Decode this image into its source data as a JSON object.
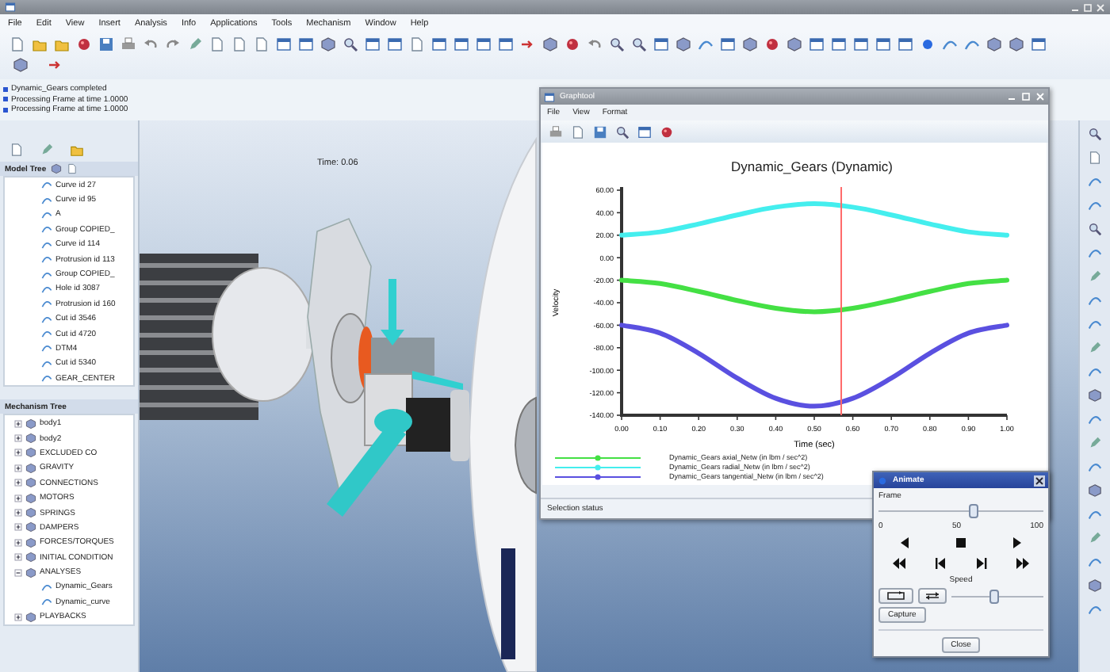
{
  "menu_bar": [
    "File",
    "Edit",
    "View",
    "Insert",
    "Analysis",
    "Info",
    "Applications",
    "Tools",
    "Mechanism",
    "Window",
    "Help"
  ],
  "messages": [
    "Dynamic_Gears completed",
    "Processing Frame at time 1.0000",
    "Processing Frame at time 1.0000"
  ],
  "model_tree": {
    "title": "Model Tree",
    "items": [
      {
        "label": "Curve id 27"
      },
      {
        "label": "Curve id 95"
      },
      {
        "label": "A"
      },
      {
        "label": "Group COPIED_"
      },
      {
        "label": "Curve id 114"
      },
      {
        "label": "Protrusion id 113"
      },
      {
        "label": "Group COPIED_"
      },
      {
        "label": "Hole id 3087"
      },
      {
        "label": "Protrusion id 160"
      },
      {
        "label": "Cut id 3546"
      },
      {
        "label": "Cut id 4720"
      },
      {
        "label": "DTM4"
      },
      {
        "label": "Cut id 5340"
      },
      {
        "label": "GEAR_CENTER"
      }
    ]
  },
  "mechanism_tree": {
    "title": "Mechanism Tree",
    "items": [
      {
        "label": "body1",
        "expanded": false
      },
      {
        "label": "body2",
        "expanded": false
      },
      {
        "label": "EXCLUDED CO",
        "expanded": false
      },
      {
        "label": "GRAVITY",
        "expanded": false
      },
      {
        "label": "CONNECTIONS",
        "expanded": false
      },
      {
        "label": "MOTORS",
        "expanded": false
      },
      {
        "label": "SPRINGS",
        "expanded": false
      },
      {
        "label": "DAMPERS",
        "expanded": false
      },
      {
        "label": "FORCES/TORQUES",
        "expanded": false
      },
      {
        "label": "INITIAL CONDITION",
        "expanded": false
      },
      {
        "label": "ANALYSES",
        "expanded": true,
        "children": [
          {
            "label": "Dynamic_Gears"
          },
          {
            "label": "Dynamic_curve"
          }
        ]
      },
      {
        "label": "PLAYBACKS",
        "expanded": false
      }
    ]
  },
  "viewport": {
    "time_label": "Time: 0.06"
  },
  "graph_window": {
    "title": "Graphtool",
    "menu": [
      "File",
      "View",
      "Format"
    ],
    "chart_data": {
      "type": "line",
      "title": "Dynamic_Gears (Dynamic)",
      "xlabel": "Time (sec)",
      "ylabel": "Velocity",
      "x": [
        0,
        0.1,
        0.2,
        0.3,
        0.4,
        0.5,
        0.6,
        0.7,
        0.8,
        0.9,
        1.0
      ],
      "series": [
        {
          "name": "Dynamic_Gears axial_Netw (in lbm / sec^2)",
          "color": "#44e044",
          "values": [
            -20,
            -23,
            -30,
            -38,
            -45,
            -48,
            -45,
            -38,
            -30,
            -23,
            -20
          ]
        },
        {
          "name": "Dynamic_Gears radial_Netw (in lbm / sec^2)",
          "color": "#44eeee",
          "values": [
            20,
            23,
            30,
            38,
            45,
            48,
            45,
            38,
            30,
            23,
            20
          ]
        },
        {
          "name": "Dynamic_Gears tangential_Netw (in lbm / sec^2)",
          "color": "#5a50e0",
          "values": [
            -60,
            -67,
            -85,
            -107,
            -125,
            -132,
            -125,
            -107,
            -85,
            -67,
            -60
          ]
        }
      ],
      "xlim": [
        0,
        1
      ],
      "ylim": [
        -140,
        60
      ],
      "xticks": [
        {
          "value": 0,
          "label": "0.00"
        },
        {
          "value": 0.1,
          "label": "0.10"
        },
        {
          "value": 0.2,
          "label": "0.20"
        },
        {
          "value": 0.3,
          "label": "0.30"
        },
        {
          "value": 0.4,
          "label": "0.40"
        },
        {
          "value": 0.5,
          "label": "0.50"
        },
        {
          "value": 0.6,
          "label": "0.60"
        },
        {
          "value": 0.7,
          "label": "0.70"
        },
        {
          "value": 0.8,
          "label": "0.80"
        },
        {
          "value": 0.9,
          "label": "0.90"
        },
        {
          "value": 1,
          "label": "1.00"
        }
      ],
      "yticks": [
        {
          "value": 60,
          "label": "60.00"
        },
        {
          "value": 40,
          "label": "40.00"
        },
        {
          "value": 20,
          "label": "20.00"
        },
        {
          "value": 0,
          "label": "0.00"
        },
        {
          "value": -20,
          "label": "-20.00"
        },
        {
          "value": -40,
          "label": "-40.00"
        },
        {
          "value": -60,
          "label": "-60.00"
        },
        {
          "value": -80,
          "label": "-80.00"
        },
        {
          "value": -100,
          "label": "-100.00"
        },
        {
          "value": -120,
          "label": "-120.00"
        },
        {
          "value": -140,
          "label": "-140.00"
        }
      ],
      "ref_lines": [
        {
          "axis": "x",
          "value": 0.57
        }
      ]
    },
    "status": "Selection status"
  },
  "animate_dialog": {
    "title": "Animate",
    "frame_label": "Frame",
    "frame_slider": {
      "level": 0.58
    },
    "frame_ticks": [
      "0",
      "50",
      "100"
    ],
    "speed_label": "Speed",
    "speed_slider": {
      "level": 0.47
    },
    "capture_button": "Capture",
    "close_button": "Close"
  }
}
